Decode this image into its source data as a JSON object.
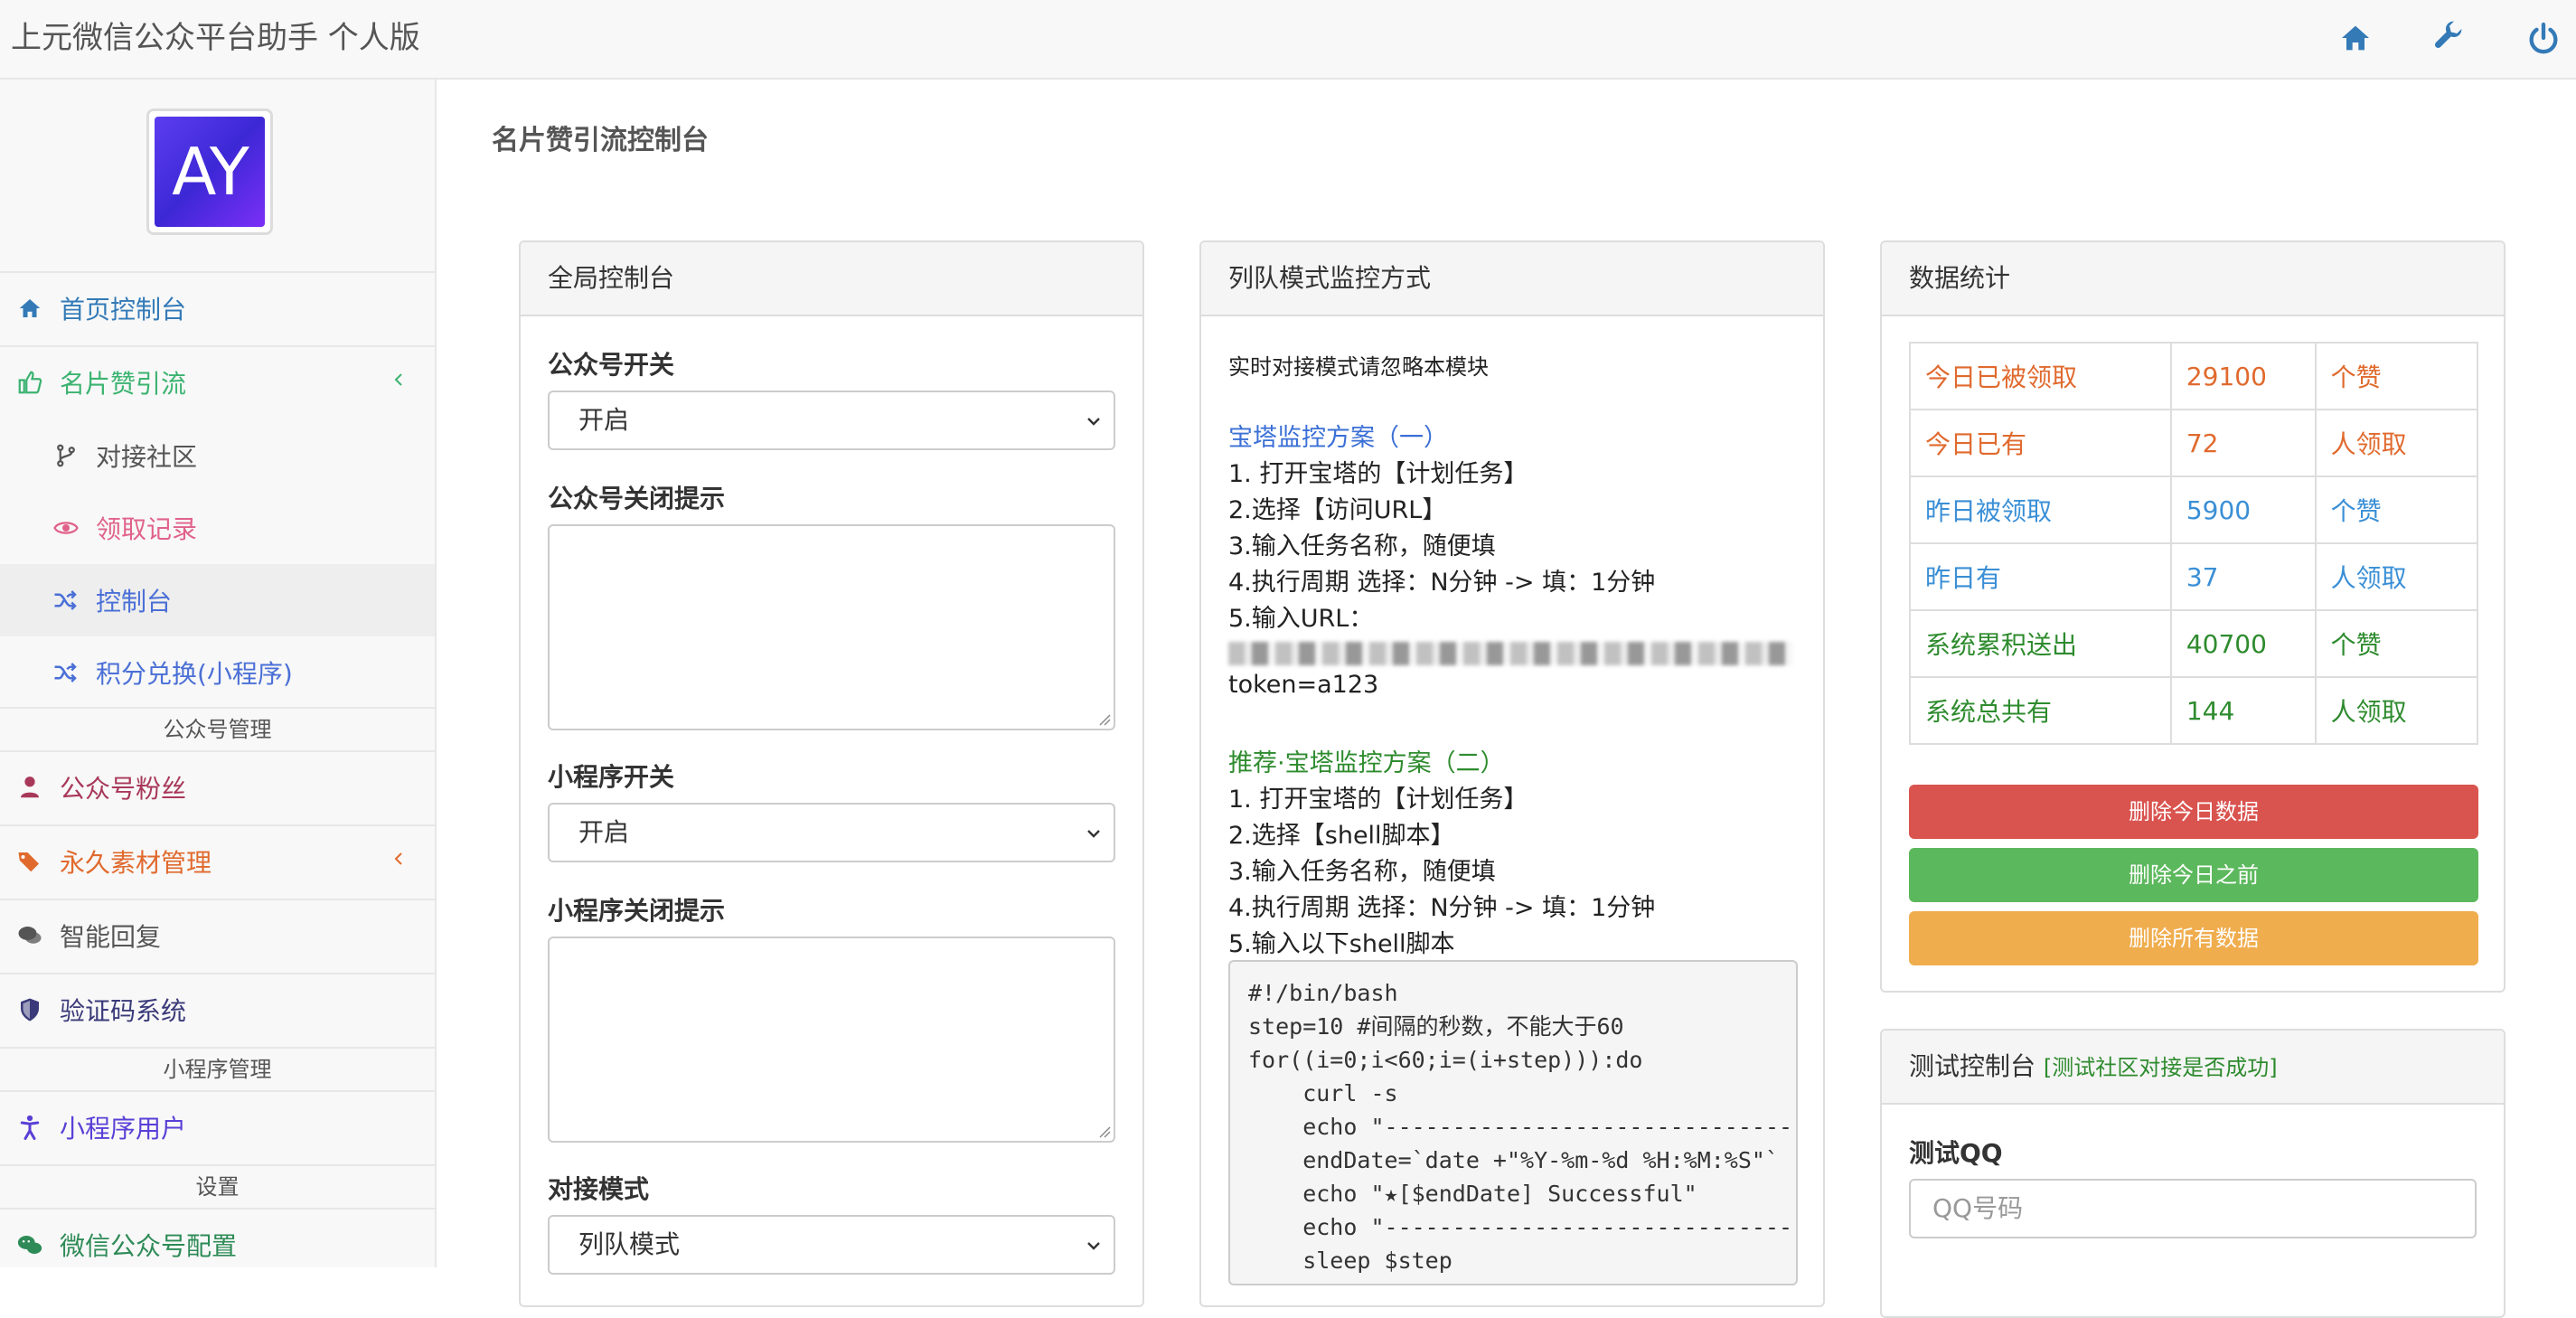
{
  "app": {
    "title": "上元微信公众平台助手 个人版"
  },
  "logo": {
    "text": "AY"
  },
  "sidebar": {
    "items": [
      {
        "label": "首页控制台",
        "icon": "home-icon",
        "color": "#337ab7"
      },
      {
        "label": "名片赞引流",
        "icon": "thumbs-up-icon",
        "color": "#3cb371"
      },
      {
        "label": "对接社区",
        "icon": "branch-icon",
        "color": "#555555"
      },
      {
        "label": "领取记录",
        "icon": "eye-icon",
        "color": "#e0628a"
      },
      {
        "label": "控制台",
        "icon": "shuffle-icon",
        "color": "#4a6fd6"
      },
      {
        "label": "积分兑换(小程序)",
        "icon": "shuffle-icon",
        "color": "#4a6fd6"
      },
      {
        "label": "公众号粉丝",
        "icon": "user-icon",
        "color": "#a8385a"
      },
      {
        "label": "永久素材管理",
        "icon": "tags-icon",
        "color": "#e06a2e"
      },
      {
        "label": "智能回复",
        "icon": "comments-icon",
        "color": "#555555"
      },
      {
        "label": "验证码系统",
        "icon": "shield-icon",
        "color": "#3a3a7a"
      },
      {
        "label": "小程序用户",
        "icon": "child-icon",
        "color": "#5a3fd6"
      },
      {
        "label": "微信公众号配置",
        "icon": "wechat-icon",
        "color": "#2e8b57"
      }
    ],
    "headers": [
      "公众号管理",
      "小程序管理",
      "设置"
    ]
  },
  "page": {
    "title": "名片赞引流控制台"
  },
  "global_panel": {
    "title": "全局控制台",
    "wx_switch_label": "公众号开关",
    "wx_switch_value": "开启",
    "wx_close_tip_label": "公众号关闭提示",
    "mini_switch_label": "小程序开关",
    "mini_switch_value": "开启",
    "mini_close_tip_label": "小程序关闭提示",
    "mode_label": "对接模式",
    "mode_value": "列队模式"
  },
  "queue_panel": {
    "title": "列队模式监控方式",
    "note": "实时对接模式请忽略本模块",
    "plan1_title": "宝塔监控方案（一）",
    "plan1_steps": [
      "1. 打开宝塔的【计划任务】",
      "2.选择【访问URL】",
      "3.输入任务名称，随便填",
      "4.执行周期 选择：N分钟 -> 填：1分钟",
      "5.输入URL："
    ],
    "token_line": "token=a123",
    "plan2_title": "推荐·宝塔监控方案（二）",
    "plan2_steps": [
      "1. 打开宝塔的【计划任务】",
      "2.选择【shell脚本】",
      "3.输入任务名称，随便填",
      "4.执行周期 选择：N分钟 -> 填：1分钟",
      "5.输入以下shell脚本"
    ],
    "script": "#!/bin/bash\nstep=10 #间隔的秒数，不能大于60\nfor((i=0;i<60;i=(i+step))):do\n    curl -s \n    echo \"-----------------------------------\n    endDate=`date +\"%Y-%m-%d %H:%M:%S\"`\n    echo \"★[$endDate] Successful\"\n    echo \"-----------------------------------\n    sleep $step"
  },
  "stats_panel": {
    "title": "数据统计",
    "rows": [
      {
        "label": "今日已被领取",
        "value": "29100",
        "unit": "个赞",
        "color": "#e06a2e"
      },
      {
        "label": "今日已有",
        "value": "72",
        "unit": "人领取",
        "color": "#e06a2e"
      },
      {
        "label": "昨日被领取",
        "value": "5900",
        "unit": "个赞",
        "color": "#3a8fd6"
      },
      {
        "label": "昨日有",
        "value": "37",
        "unit": "人领取",
        "color": "#3a8fd6"
      },
      {
        "label": "系统累积送出",
        "value": "40700",
        "unit": "个赞",
        "color": "#2e8b2e"
      },
      {
        "label": "系统总共有",
        "value": "144",
        "unit": "人领取",
        "color": "#2e8b2e"
      }
    ],
    "btn_delete_today": "删除今日数据",
    "btn_delete_before": "删除今日之前",
    "btn_delete_all": "删除所有数据",
    "colors": {
      "danger": "#d9534f",
      "success": "#5cb85c",
      "warning": "#f0ad4e"
    }
  },
  "test_panel": {
    "title": "测试控制台",
    "note": "[测试社区对接是否成功]",
    "qq_label": "测试QQ",
    "qq_placeholder": "QQ号码"
  }
}
